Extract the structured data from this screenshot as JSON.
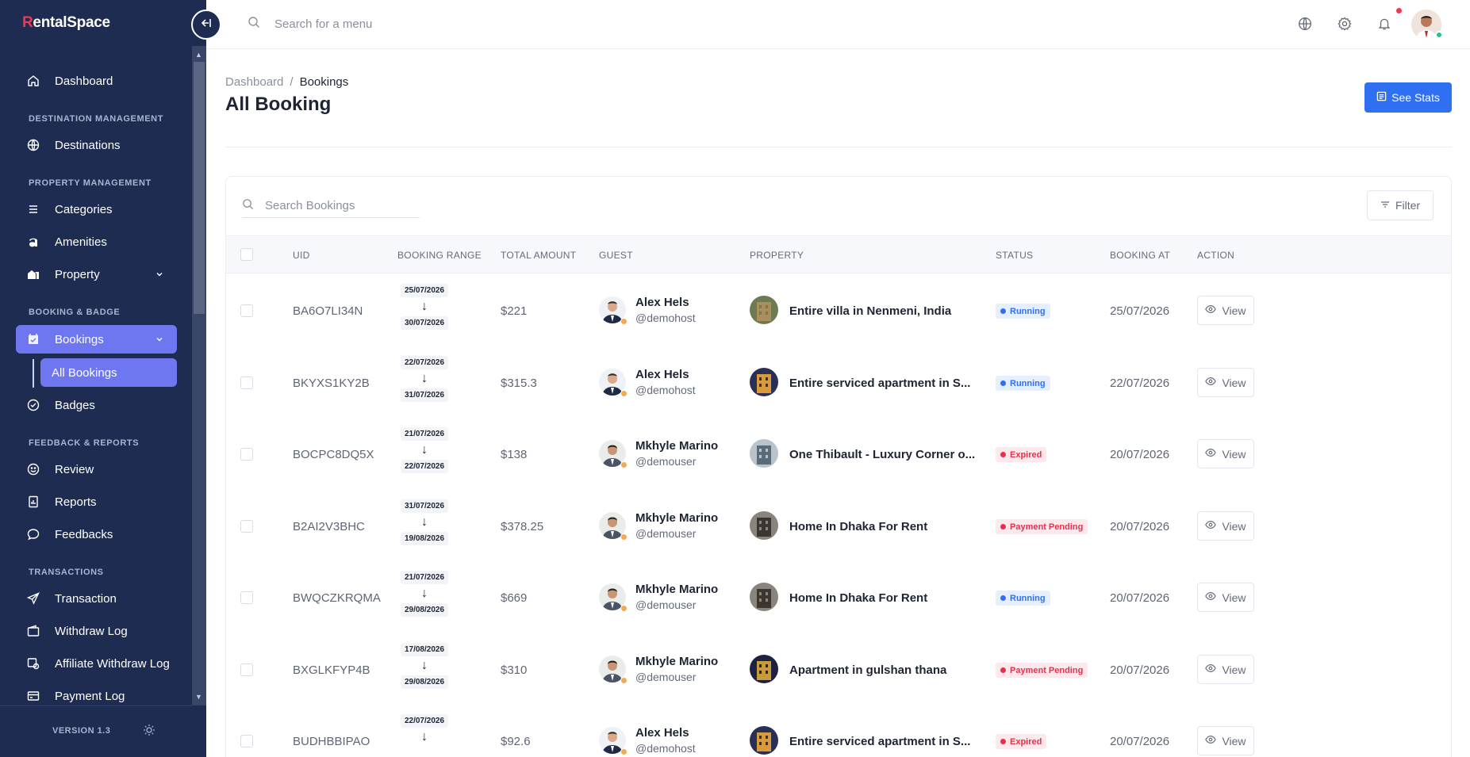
{
  "app": {
    "logo_first": "R",
    "logo_rest": "entalSpace",
    "version": "VERSION 1.3"
  },
  "colors": {
    "sidebar": "#1e2c52",
    "accent": "#6f77f0",
    "primary": "#2f6ff1",
    "danger": "#e8304e"
  },
  "sidebar": {
    "dashboard": "Dashboard",
    "sec_destination": "DESTINATION MANAGEMENT",
    "destinations": "Destinations",
    "sec_property": "PROPERTY MANAGEMENT",
    "categories": "Categories",
    "amenities": "Amenities",
    "property": "Property",
    "sec_booking": "BOOKING & BADGE",
    "bookings": "Bookings",
    "all_bookings": "All Bookings",
    "badges": "Badges",
    "sec_feedback": "FEEDBACK & REPORTS",
    "review": "Review",
    "reports": "Reports",
    "feedbacks": "Feedbacks",
    "sec_transactions": "TRANSACTIONS",
    "transaction": "Transaction",
    "withdraw_log": "Withdraw Log",
    "affiliate_withdraw_log": "Affiliate Withdraw Log",
    "payment_log": "Payment Log"
  },
  "topbar": {
    "search_placeholder": "Search for a menu"
  },
  "page": {
    "breadcrumb_root": "Dashboard",
    "breadcrumb_sep": "/",
    "breadcrumb_current": "Bookings",
    "title": "All Booking",
    "stats_button": "See Stats"
  },
  "table": {
    "search_placeholder": "Search Bookings",
    "filter_label": "Filter",
    "headers": {
      "uid": "UID",
      "range": "BOOKING RANGE",
      "amount": "TOTAL AMOUNT",
      "guest": "GUEST",
      "property": "PROPERTY",
      "status": "STATUS",
      "booking_at": "BOOKING AT",
      "action": "ACTION"
    },
    "rows": [
      {
        "uid": "BA6O7LI34N",
        "start": "25/07/2026",
        "end": "30/07/2026",
        "amount": "$221",
        "guest": "Alex Hels",
        "handle": "@demohost",
        "property": "Entire villa in Nenmeni, India",
        "status": "Running",
        "status_type": "running",
        "booking_at": "25/07/2026",
        "action": "View"
      },
      {
        "uid": "BKYXS1KY2B",
        "start": "22/07/2026",
        "end": "31/07/2026",
        "amount": "$315.3",
        "guest": "Alex Hels",
        "handle": "@demohost",
        "property": "Entire serviced apartment in S...",
        "status": "Running",
        "status_type": "running",
        "booking_at": "22/07/2026",
        "action": "View"
      },
      {
        "uid": "BOCPC8DQ5X",
        "start": "21/07/2026",
        "end": "22/07/2026",
        "amount": "$138",
        "guest": "Mkhyle Marino",
        "handle": "@demouser",
        "property": "One Thibault - Luxury Corner o...",
        "status": "Expired",
        "status_type": "expired",
        "booking_at": "20/07/2026",
        "action": "View"
      },
      {
        "uid": "B2AI2V3BHC",
        "start": "31/07/2026",
        "end": "19/08/2026",
        "amount": "$378.25",
        "guest": "Mkhyle Marino",
        "handle": "@demouser",
        "property": "Home In Dhaka For Rent",
        "status": "Payment Pending",
        "status_type": "pending",
        "booking_at": "20/07/2026",
        "action": "View"
      },
      {
        "uid": "BWQCZKRQMA",
        "start": "21/07/2026",
        "end": "29/08/2026",
        "amount": "$669",
        "guest": "Mkhyle Marino",
        "handle": "@demouser",
        "property": "Home In Dhaka For Rent",
        "status": "Running",
        "status_type": "running",
        "booking_at": "20/07/2026",
        "action": "View"
      },
      {
        "uid": "BXGLKFYP4B",
        "start": "17/08/2026",
        "end": "29/08/2026",
        "amount": "$310",
        "guest": "Mkhyle Marino",
        "handle": "@demouser",
        "property": "Apartment in gulshan thana",
        "status": "Payment Pending",
        "status_type": "pending",
        "booking_at": "20/07/2026",
        "action": "View"
      },
      {
        "uid": "BUDHBBIPAO",
        "start": "22/07/2026",
        "end": "",
        "amount": "$92.6",
        "guest": "Alex Hels",
        "handle": "@demohost",
        "property": "Entire serviced apartment in S...",
        "status": "Expired",
        "status_type": "expired",
        "booking_at": "20/07/2026",
        "action": "View"
      }
    ]
  }
}
